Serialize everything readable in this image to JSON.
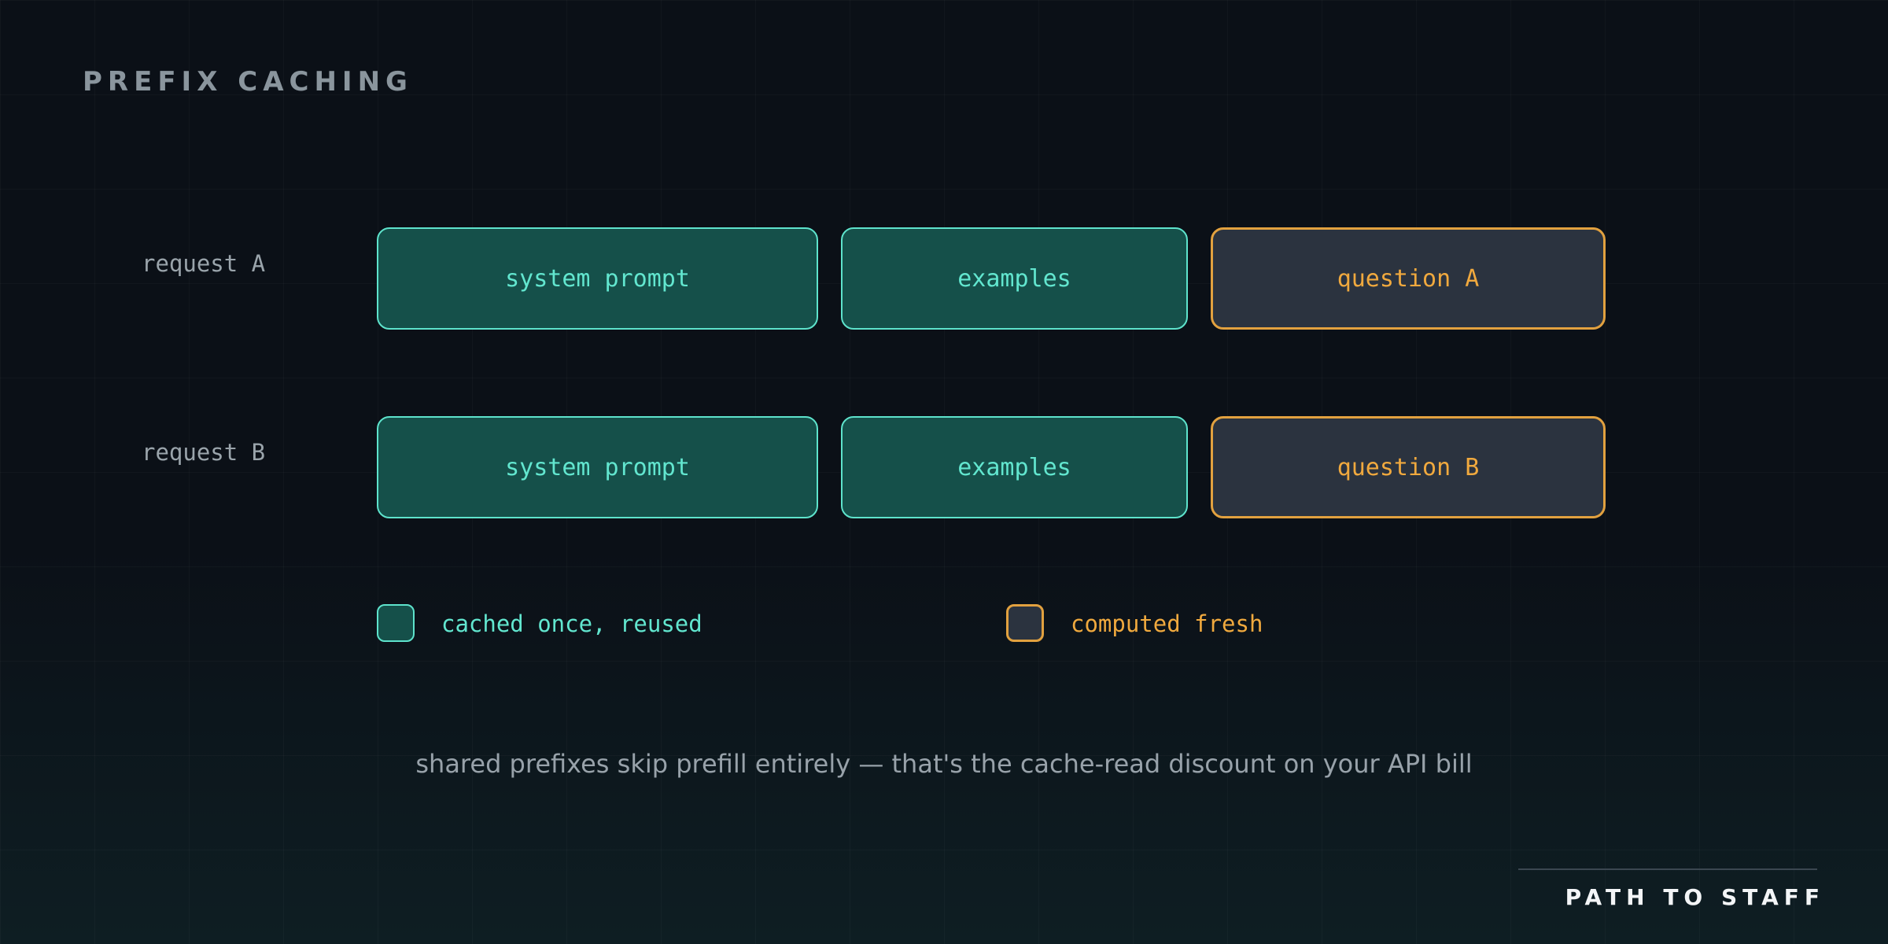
{
  "title": "PREFIX CACHING",
  "requests": [
    {
      "label": "request A",
      "segments": [
        {
          "label": "system prompt",
          "kind": "cached"
        },
        {
          "label": "examples",
          "kind": "cached"
        },
        {
          "label": "question A",
          "kind": "fresh"
        }
      ]
    },
    {
      "label": "request B",
      "segments": [
        {
          "label": "system prompt",
          "kind": "cached"
        },
        {
          "label": "examples",
          "kind": "cached"
        },
        {
          "label": "question B",
          "kind": "fresh"
        }
      ]
    }
  ],
  "legend": {
    "cached": "cached once, reused",
    "fresh": "computed fresh"
  },
  "caption": "shared prefixes skip prefill entirely — that's the cache-read discount on your API bill",
  "footer": "PATH TO STAFF",
  "colors": {
    "background": "#0b1017",
    "cached_fill": "#15504a",
    "cached_accent": "#5ee3cc",
    "fresh_fill": "#2b333f",
    "fresh_accent": "#e2a13f"
  }
}
